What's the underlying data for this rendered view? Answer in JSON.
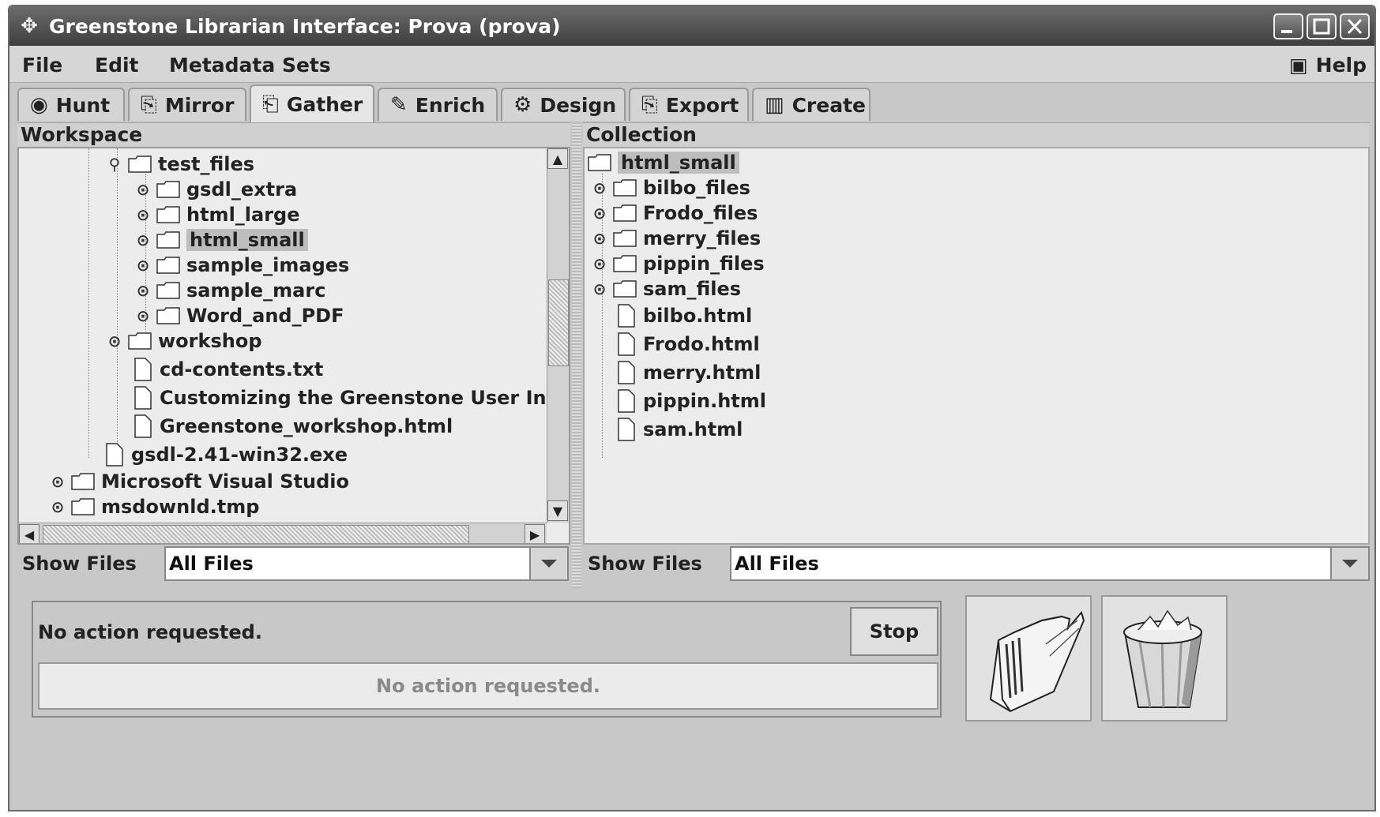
{
  "window": {
    "title": "Greenstone Librarian Interface: Prova (prova)"
  },
  "menu": {
    "file": "File",
    "edit": "Edit",
    "metadata_sets": "Metadata Sets",
    "help": "Help"
  },
  "tabs": [
    {
      "label": "Hunt",
      "icon": "target-icon"
    },
    {
      "label": "Mirror",
      "icon": "mirror-icon"
    },
    {
      "label": "Gather",
      "icon": "gather-icon",
      "active": true
    },
    {
      "label": "Enrich",
      "icon": "enrich-icon"
    },
    {
      "label": "Design",
      "icon": "gear-icon"
    },
    {
      "label": "Export",
      "icon": "export-icon"
    },
    {
      "label": "Create",
      "icon": "film-icon"
    }
  ],
  "workspace": {
    "header": "Workspace",
    "tree": [
      {
        "label": "test_files",
        "type": "folder",
        "expanded": true
      },
      {
        "label": "gsdl_extra",
        "type": "folder"
      },
      {
        "label": "html_large",
        "type": "folder"
      },
      {
        "label": "html_small",
        "type": "folder",
        "selected": true
      },
      {
        "label": "sample_images",
        "type": "folder"
      },
      {
        "label": "sample_marc",
        "type": "folder"
      },
      {
        "label": "Word_and_PDF",
        "type": "folder"
      },
      {
        "label": "workshop",
        "type": "folder"
      },
      {
        "label": "cd-contents.txt",
        "type": "file"
      },
      {
        "label": "Customizing the Greenstone User Interfa",
        "type": "file"
      },
      {
        "label": "Greenstone_workshop.html",
        "type": "file"
      },
      {
        "label": "gsdl-2.41-win32.exe",
        "type": "file"
      },
      {
        "label": "Microsoft Visual Studio",
        "type": "folder"
      },
      {
        "label": "msdownld.tmp",
        "type": "folder"
      }
    ],
    "show_files_label": "Show Files",
    "filter": "All Files"
  },
  "collection": {
    "header": "Collection",
    "tree": [
      {
        "label": "html_small",
        "type": "folder",
        "selected": true
      },
      {
        "label": "bilbo_files",
        "type": "folder"
      },
      {
        "label": "Frodo_files",
        "type": "folder"
      },
      {
        "label": "merry_files",
        "type": "folder"
      },
      {
        "label": "pippin_files",
        "type": "folder"
      },
      {
        "label": "sam_files",
        "type": "folder"
      },
      {
        "label": "bilbo.html",
        "type": "file"
      },
      {
        "label": "Frodo.html",
        "type": "file"
      },
      {
        "label": "merry.html",
        "type": "file"
      },
      {
        "label": "pippin.html",
        "type": "file"
      },
      {
        "label": "sam.html",
        "type": "file"
      }
    ],
    "show_files_label": "Show Files",
    "filter": "All Files"
  },
  "status": {
    "message": "No action requested.",
    "progress_text": "No action requested.",
    "stop_label": "Stop"
  }
}
